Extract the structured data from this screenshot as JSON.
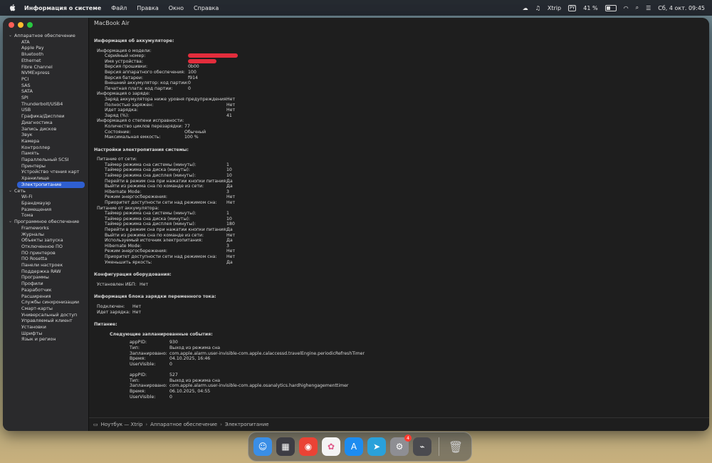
{
  "menubar": {
    "app_name": "Информация о системе",
    "menus": [
      "Файл",
      "Правка",
      "Окно",
      "Справка"
    ],
    "xtrip": "Xtrip",
    "battery_percent": "41 %",
    "battery_level": 0.41,
    "datetime": "Сб, 4 окт.  09:45"
  },
  "window": {
    "title": "MacBook Air"
  },
  "sidebar": {
    "categories": [
      {
        "label": "Аппаратное обеспечение",
        "items": [
          "ATA",
          "Apple Pay",
          "Bluetooth",
          "Ethernet",
          "Fibre Channel",
          "NVMExpress",
          "PCI",
          "SAS",
          "SATA",
          "SPI",
          "Thunderbolt/USB4",
          "USB",
          "Графика/Дисплеи",
          "Диагностика",
          "Запись дисков",
          "Звук",
          "Камера",
          "Контроллер",
          "Память",
          "Параллельный SCSI",
          "Принтеры",
          "Устройство чтения карт",
          "Хранилище",
          "Электропитание"
        ]
      },
      {
        "label": "Сеть",
        "items": [
          "Wi-Fi",
          "Брандмауэр",
          "Размещения",
          "Тома"
        ]
      },
      {
        "label": "Программное обеспечение",
        "items": [
          "Frameworks",
          "Журналы",
          "Объекты запуска",
          "Отключенное ПО",
          "ПО принтеров",
          "ПО Rosetta",
          "Панели настроек",
          "Поддержка RAW",
          "Программы",
          "Профили",
          "Разработчик",
          "Расширения",
          "Службы синхронизации",
          "Смарт-карты",
          "Универсальный доступ",
          "Управляемый клиент",
          "Установки",
          "Шрифты",
          "Язык и регион"
        ]
      }
    ],
    "selected": "Электропитание"
  },
  "battery": {
    "title": "Информация об аккумуляторе:",
    "model_title": "Информация о модели:",
    "model": [
      [
        "Серийный номер:",
        ""
      ],
      [
        "Имя устройства:",
        ""
      ],
      [
        "Версия прошивки:",
        "0b00"
      ],
      [
        "Версия аппаратного обеспечения:",
        "100"
      ],
      [
        "Версия батареи:",
        "f914"
      ],
      [
        "Внешний аккумулятор: код партии:",
        "0"
      ],
      [
        "Печатная плата: код партии:",
        "0"
      ]
    ],
    "charge_title": "Информация о заряде:",
    "charge": [
      [
        "Заряд аккумулятора ниже уровня предупреждения:",
        "Нет"
      ],
      [
        "Полностью заряжен:",
        "Нет"
      ],
      [
        "Идет зарядка:",
        "Нет"
      ],
      [
        "Заряд (%):",
        "41"
      ]
    ],
    "health_title": "Информация о степени исправности:",
    "health": [
      [
        "Количество циклов перезарядки:",
        "77"
      ],
      [
        "Состояние:",
        "Обычный"
      ],
      [
        "Максимальная емкость:",
        "100 %"
      ]
    ]
  },
  "power": {
    "title": "Настройки электропитания системы:",
    "ac_title": "Питание от сети:",
    "ac": [
      [
        "Таймер режима сна системы (минуты):",
        "1"
      ],
      [
        "Таймер режима сна диска (минуты):",
        "10"
      ],
      [
        "Таймер режима сна дисплея (минуты):",
        "10"
      ],
      [
        "Перейти в режим сна при нажатии кнопки питания:",
        "Да"
      ],
      [
        "Выйти из режима сна по команде из сети:",
        "Да"
      ],
      [
        "Hibernate Mode:",
        "3"
      ],
      [
        "Режим энергосбережения:",
        "Нет"
      ],
      [
        "Приоритет доступности сети над режимом сна:",
        "Нет"
      ]
    ],
    "batt_title": "Питание от аккумулятора:",
    "batt": [
      [
        "Таймер режима сна системы (минуты):",
        "1"
      ],
      [
        "Таймер режима сна диска (минуты):",
        "10"
      ],
      [
        "Таймер режима сна дисплея (минуты):",
        "180"
      ],
      [
        "Перейти в режим сна при нажатии кнопки питания:",
        "Да"
      ],
      [
        "Выйти из режима сна по команде из сети:",
        "Нет"
      ],
      [
        "Используемый источник электропитания:",
        "Да"
      ],
      [
        "Hibernate Mode:",
        "3"
      ],
      [
        "Режим энергосбережения:",
        "Нет"
      ],
      [
        "Приоритет доступности сети над режимом сна:",
        "Нет"
      ],
      [
        "Уменьшить яркость:",
        "Да"
      ]
    ]
  },
  "hardware": {
    "title": "Конфигурация оборудования:",
    "ups_label": "Установлен ИБП:",
    "ups_value": "Нет"
  },
  "ac_charger": {
    "title": "Информация блока зарядки переменного тока:",
    "rows": [
      [
        "Подключен:",
        "Нет"
      ],
      [
        "Идет зарядка:",
        "Нет"
      ]
    ]
  },
  "power_events": {
    "title": "Питание:",
    "subtitle": "Следующие запланированные события:",
    "events": [
      {
        "rows": [
          [
            "appPID:",
            "930"
          ],
          [
            "Тип:",
            "Выход из режима сна"
          ],
          [
            "Запланировано:",
            "com.apple.alarm.user-invisible-com.apple.calaccessd.travelEngine.periodicRefreshTimer"
          ],
          [
            "Время:",
            "04.10.2025, 16:46"
          ],
          [
            "UserVisible:",
            "0"
          ]
        ]
      },
      {
        "rows": [
          [
            "appPID:",
            "527"
          ],
          [
            "Тип:",
            "Выход из режима сна"
          ],
          [
            "Запланировано:",
            "com.apple.alarm.user-invisible-com.apple.osanalytics.hardhighengagementtimer"
          ],
          [
            "Время:",
            "06.10.2025, 04:55"
          ],
          [
            "UserVisible:",
            "0"
          ]
        ]
      }
    ]
  },
  "pathbar": {
    "parts": [
      "Ноутбук — Xtrip",
      "Аппаратное обеспечение",
      "Электропитание"
    ],
    "separator": "›"
  },
  "dock": {
    "apps": [
      {
        "icon": "finder-icon",
        "color": "#3a8ee6",
        "glyph": "☺"
      },
      {
        "icon": "launchpad-icon",
        "color": "#3d3d44",
        "glyph": "▦"
      },
      {
        "icon": "chrome-icon",
        "color": "#ea4335",
        "glyph": "◉"
      },
      {
        "icon": "photos-icon",
        "color": "#f4f4f4",
        "glyph": "✿"
      },
      {
        "icon": "app-store-icon",
        "color": "#1d8cf0",
        "glyph": "A"
      },
      {
        "icon": "telegram-icon",
        "color": "#2aa1da",
        "glyph": "➤"
      },
      {
        "icon": "system-settings-icon",
        "color": "#8e8e93",
        "glyph": "⚙",
        "badge": "4"
      },
      {
        "icon": "system-information-icon",
        "color": "#4a4a4f",
        "glyph": "⌁"
      }
    ],
    "trash_icon": "trash-icon"
  },
  "colors": {
    "selection": "#2f5fd0",
    "redaction": "#e32d3c"
  }
}
